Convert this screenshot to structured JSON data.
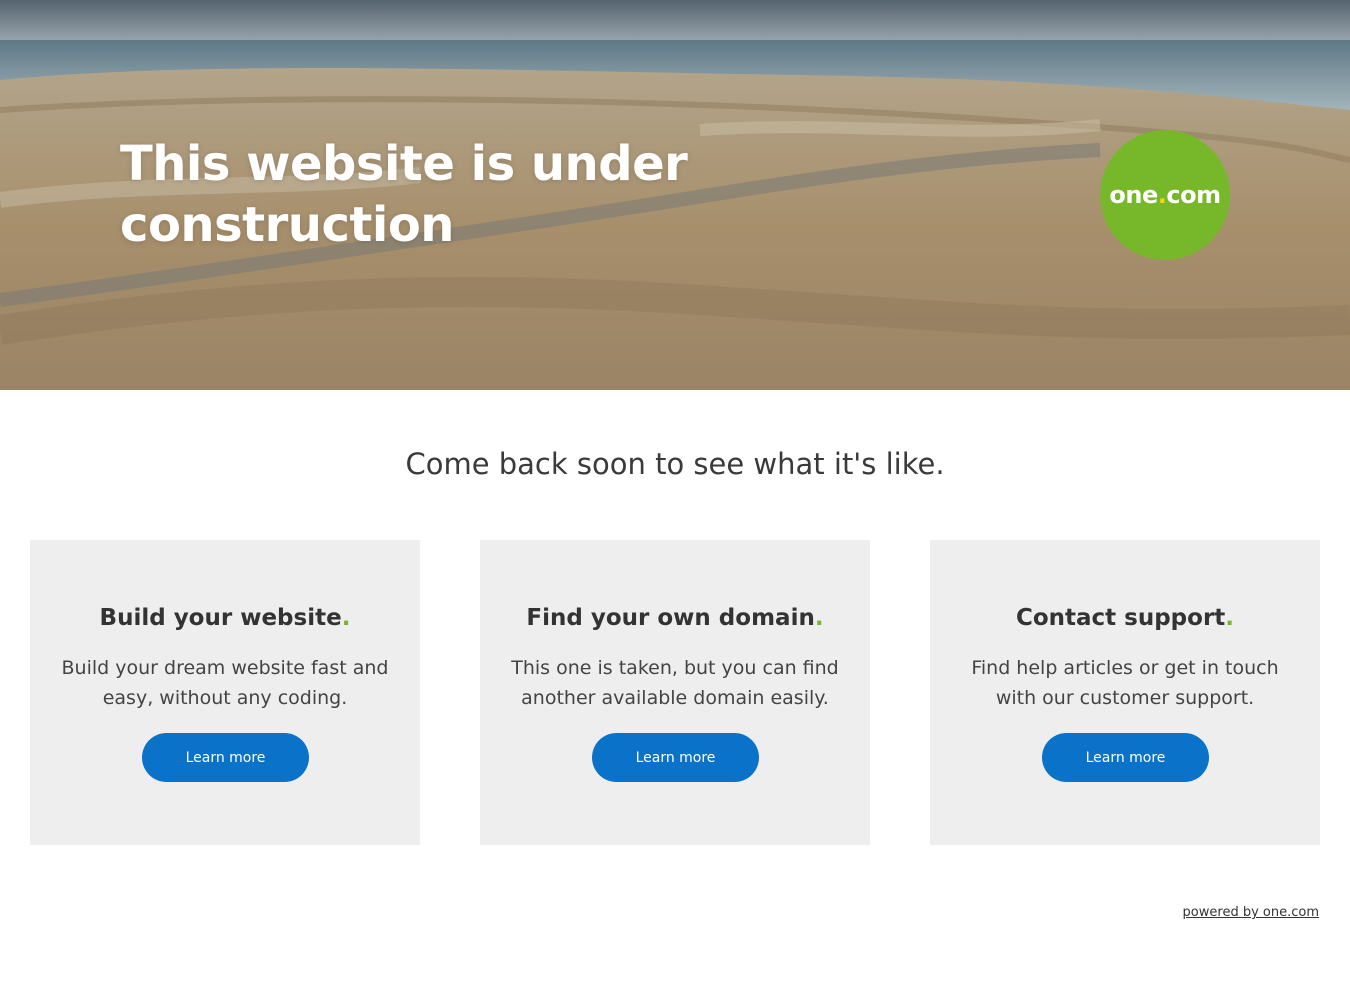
{
  "hero": {
    "title": "This website is under construction",
    "logo_text": "one",
    "logo_dot": ".",
    "logo_suffix": "com"
  },
  "tagline": "Come back soon to see what it's like.",
  "cards": [
    {
      "title": "Build your website",
      "dot": ".",
      "text": "Build your dream website fast and easy, without any coding.",
      "button": "Learn more"
    },
    {
      "title": "Find your own domain",
      "dot": ".",
      "text": "This one is taken, but you can find another available domain easily.",
      "button": "Learn more"
    },
    {
      "title": "Contact support",
      "dot": ".",
      "text": "Find help articles or get in touch with our customer support.",
      "button": "Learn more"
    }
  ],
  "footer": {
    "powered_by": "powered by one.com"
  },
  "colors": {
    "brand_green": "#76b82a",
    "button_blue": "#0a72c8",
    "card_bg": "#eeeeee"
  }
}
